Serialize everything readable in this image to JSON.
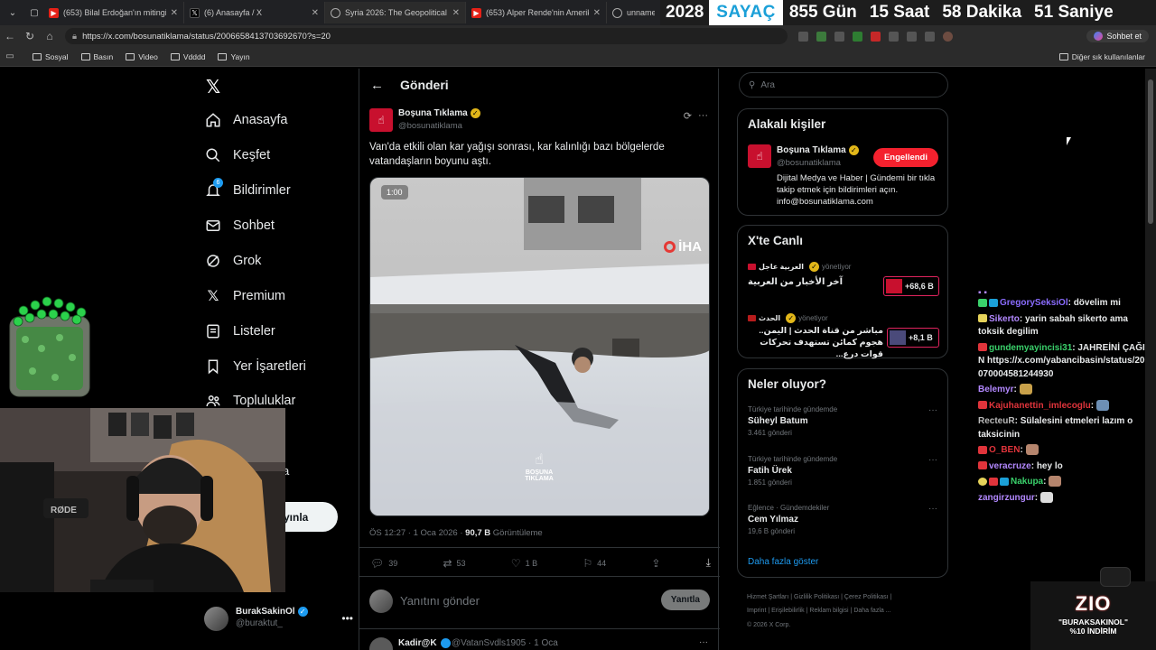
{
  "browser": {
    "tabs": [
      {
        "title": "(653) Bilal Erdoğan'ın mitingine k",
        "icon": "youtube-icon"
      },
      {
        "title": "(6) Anasayfa / X",
        "icon": "x-icon"
      },
      {
        "title": "Syria 2026: The Geopolitical Map",
        "icon": "site-icon"
      },
      {
        "title": "(653) Alper Rende'nin Amerikan",
        "icon": "youtube-icon"
      },
      {
        "title": "unnamed",
        "icon": "globe-icon"
      }
    ],
    "url": "https://x.com/bosunatiklama/status/2006658413703692670?s=20",
    "sohbet_label": "Sohbet et",
    "bookmarks": [
      "Sosyal",
      "Basın",
      "Video",
      "Vdddd",
      "Yayın"
    ],
    "other_bookmarks": "Diğer sık kullanılanlar"
  },
  "countdown": {
    "year": "2028",
    "label": "SAYAÇ",
    "days": "855 Gün",
    "hours": "15 Saat",
    "minutes": "58 Dakika",
    "seconds": "51 Saniye"
  },
  "nav": {
    "items": [
      {
        "label": "Anasayfa",
        "icon": "home-icon"
      },
      {
        "label": "Keşfet",
        "icon": "search-icon"
      },
      {
        "label": "Bildirimler",
        "icon": "bell-icon",
        "badge": "6"
      },
      {
        "label": "Sohbet",
        "icon": "mail-icon"
      },
      {
        "label": "Grok",
        "icon": "grok-icon"
      },
      {
        "label": "Premium",
        "icon": "x-icon"
      },
      {
        "label": "Listeler",
        "icon": "list-icon"
      },
      {
        "label": "Yer İşaretleri",
        "icon": "bookmark-icon"
      },
      {
        "label": "Topluluklar",
        "icon": "people-icon"
      }
    ],
    "partial_more": "a",
    "post_button": "yınla",
    "account_name": "BurakSakinOl",
    "account_handle": "@buraktut_"
  },
  "post": {
    "header": "Gönderi",
    "author_name": "Boşuna Tıklama",
    "author_handle": "@bosunatiklama",
    "text": "Van'da etkili olan kar yağışı sonrası, kar kalınlığı bazı bölgelerde vatandaşların boyunu aştı.",
    "video_time": "1:00",
    "video_watermark": "İHA",
    "video_logo": "BOŞUNA TIKLAMA",
    "meta_time": "ÖS 12:27 · 1 Oca 2026 · ",
    "views": "90,7 B",
    "views_label": " Görüntüleme",
    "replies": "39",
    "reposts": "53",
    "likes": "1 B",
    "bookmarks": "44",
    "reply_placeholder": "Yanıtını gönder",
    "reply_button": "Yanıtla",
    "next_author": "Kadir@K",
    "next_handle": "@VatanSvdls1905 · 1 Oca"
  },
  "sidebar": {
    "search_placeholder": "Ara",
    "related_title": "Alakalı kişiler",
    "related_name": "Boşuna Tıklama",
    "related_handle": "@bosunatiklama",
    "related_button": "Engellendi",
    "related_bio": "Dijital Medya ve Haber | Gündemi bir tıkla takip etmek için bildirimleri açın. info@bosunatiklama.com",
    "live_title": "X'te Canlı",
    "live": [
      {
        "host": "العربية عاجل",
        "role": "yönetiyor",
        "title": "آخر الأخبار من العربية",
        "count": "+68,6 B"
      },
      {
        "host": "الحدث",
        "role": "yönetiyor",
        "title": "مباشر من قناة الحدث | اليمن.. هجوم كمائن تستهدف تحركات قوات درع...",
        "count": "+8,1 B"
      }
    ],
    "trends_title": "Neler oluyor?",
    "trends": [
      {
        "category": "Türkiye tarihinde gündemde",
        "name": "Süheyl Batum",
        "count": "3.461 gönderi"
      },
      {
        "category": "Türkiye tarihinde gündemde",
        "name": "Fatih Ürek",
        "count": "1.851 gönderi"
      },
      {
        "category": "Eğlence · Gündemdekiler",
        "name": "Cem Yılmaz",
        "count": "19,6 B gönderi"
      }
    ],
    "show_more": "Daha fazla göster",
    "footer": [
      "Hizmet Şartları",
      "Gizlilik Politikası",
      "Çerez Politikası",
      "Imprint",
      "Erişilebilirlik",
      "Reklam bilgisi",
      "Daha fazla ...",
      "© 2026 X Corp."
    ]
  },
  "chat": [
    {
      "user": "GregorySeksiOl",
      "text": "dövelim mi",
      "color": "#8a6cff"
    },
    {
      "user": "Sikerto",
      "text": "yarin sabah sikerto ama toksik degilim",
      "color": "#b388ff"
    },
    {
      "user": "gundemyayincisi31",
      "text": "JAHREİNİ ÇAĞIRIN https://x.com/yabancibasin/status/2007070004581244930",
      "color": "#3ad16b"
    },
    {
      "user": "Belemyr",
      "text": "",
      "color": "#b388ff"
    },
    {
      "user": "Kajuhanettin_imlecoglu",
      "text": "",
      "color": "#e0343b"
    },
    {
      "user": "RecteuR",
      "text": "Sülalesini etmeleri lazım o taksicinin",
      "color": "#bbbbbb"
    },
    {
      "user": "O_BEN",
      "text": "",
      "color": "#e0343b"
    },
    {
      "user": "veracruze",
      "text": "hey lo",
      "color": "#b388ff"
    },
    {
      "user": "Nakupa",
      "text": "",
      "color": "#3ad16b"
    },
    {
      "user": "zangirzungur",
      "text": "",
      "color": "#b388ff"
    }
  ],
  "promo": {
    "brand": "ZIO",
    "code": "\"BURAKSAKINOL\"",
    "discount": "%10 İNDİRİM"
  },
  "colors": {
    "accent": "#1d9bf0",
    "blocked": "#f4212e",
    "brand_red": "#c8102e"
  }
}
